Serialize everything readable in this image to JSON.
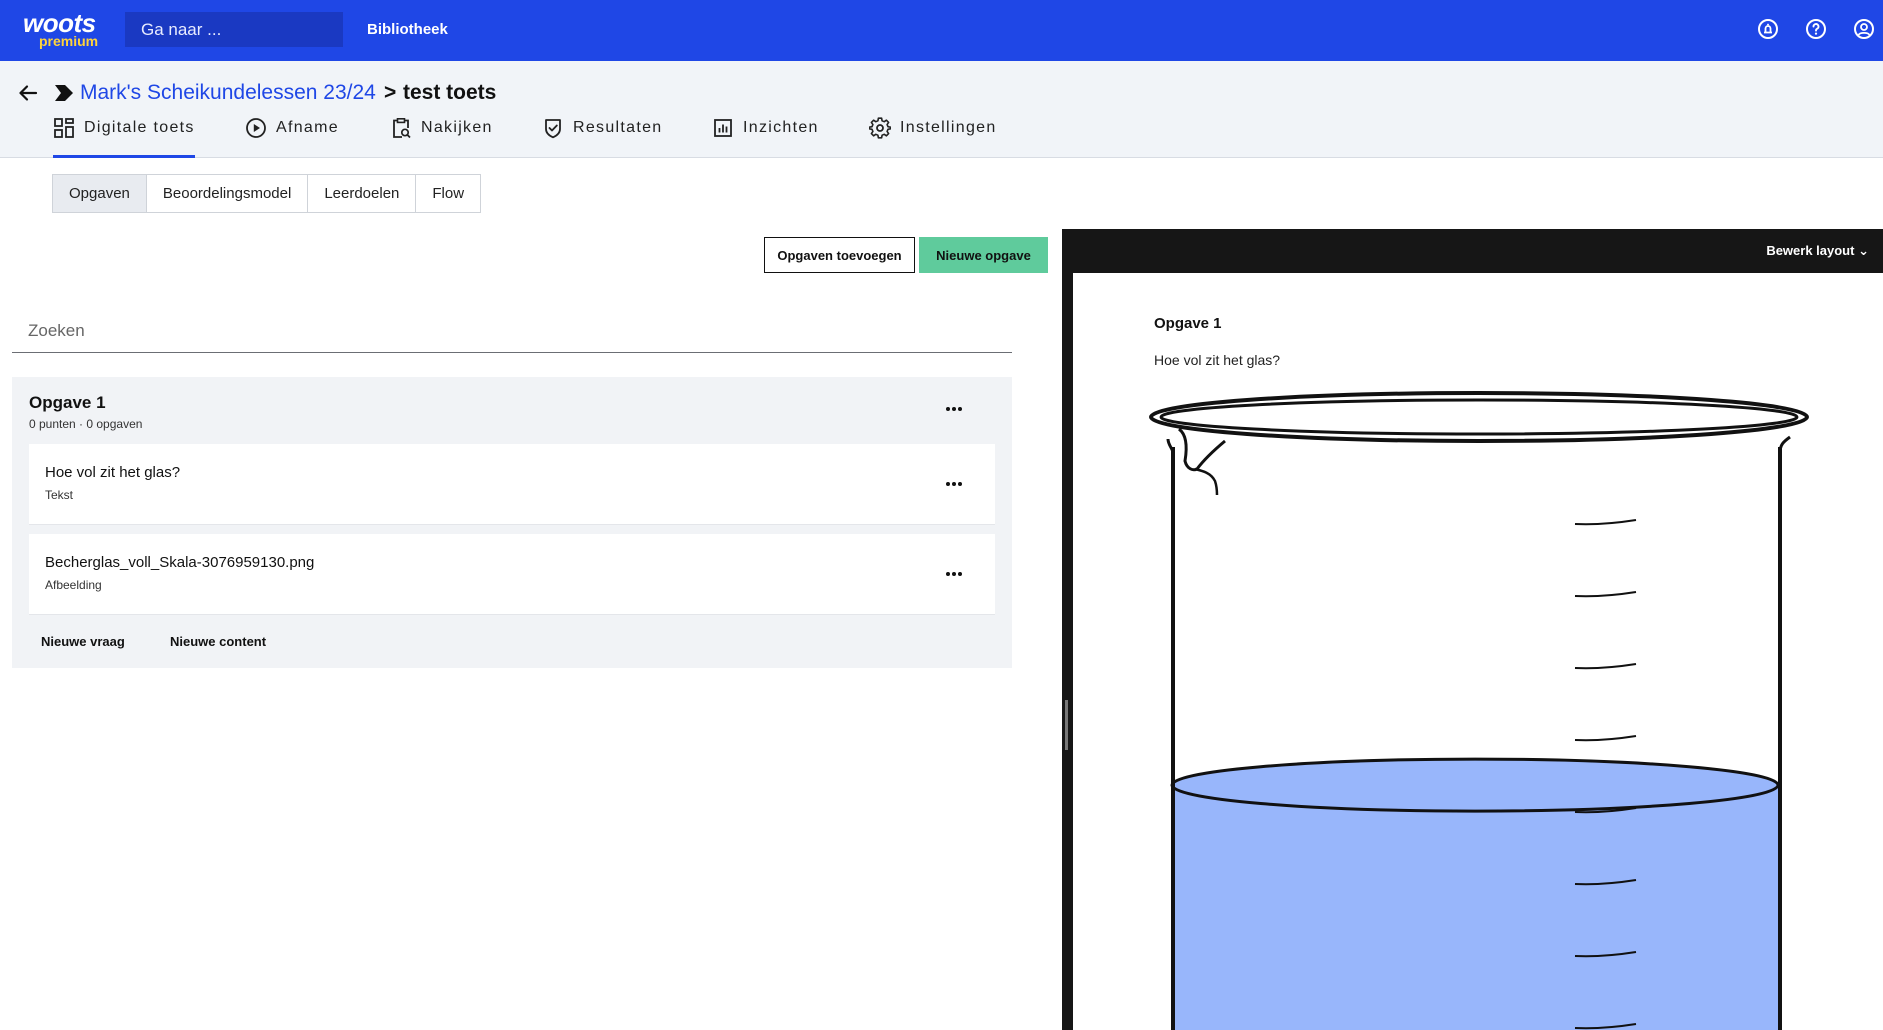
{
  "topbar": {
    "logo_main": "woots",
    "logo_sub": "premium",
    "search_placeholder": "Ga naar ...",
    "library_label": "Bibliotheek",
    "icons": [
      "notification-icon",
      "help-icon",
      "account-icon"
    ]
  },
  "breadcrumb": {
    "parent": "Mark's Scheikundelessen 23/24",
    "separator": ">",
    "current": "test toets"
  },
  "tabs": [
    {
      "label": "Digitale toets",
      "icon": "grid-icon",
      "active": true
    },
    {
      "label": "Afname",
      "icon": "play-icon",
      "active": false
    },
    {
      "label": "Nakijken",
      "icon": "clipboard-search-icon",
      "active": false
    },
    {
      "label": "Resultaten",
      "icon": "shield-check-icon",
      "active": false
    },
    {
      "label": "Inzichten",
      "icon": "bar-chart-icon",
      "active": false
    },
    {
      "label": "Instellingen",
      "icon": "gear-icon",
      "active": false
    }
  ],
  "subtabs": [
    {
      "label": "Opgaven",
      "active": true
    },
    {
      "label": "Beoordelingsmodel",
      "active": false
    },
    {
      "label": "Leerdoelen",
      "active": false
    },
    {
      "label": "Flow",
      "active": false
    }
  ],
  "actions": {
    "add_existing": "Opgaven toevoegen",
    "new_question": "Nieuwe opgave"
  },
  "search": {
    "placeholder": "Zoeken"
  },
  "group": {
    "title": "Opgave 1",
    "subtitle": "0 punten · 0 opgaven",
    "items": [
      {
        "title": "Hoe vol zit het glas?",
        "type": "Tekst"
      },
      {
        "title": "Becherglas_voll_Skala-3076959130.png",
        "type": "Afbeelding"
      }
    ],
    "new_question_label": "Nieuwe vraag",
    "new_content_label": "Nieuwe content"
  },
  "preview": {
    "edit_layout_label": "Bewerk layout",
    "title": "Opgave 1",
    "question": "Hoe vol zit het glas?",
    "image_fill_color": "#98b6fb",
    "fill_level": 0.3
  },
  "colors": {
    "brand_blue": "#1f47e6",
    "accent_green": "#5fcb9c",
    "logo_yellow": "#ffd43b"
  }
}
